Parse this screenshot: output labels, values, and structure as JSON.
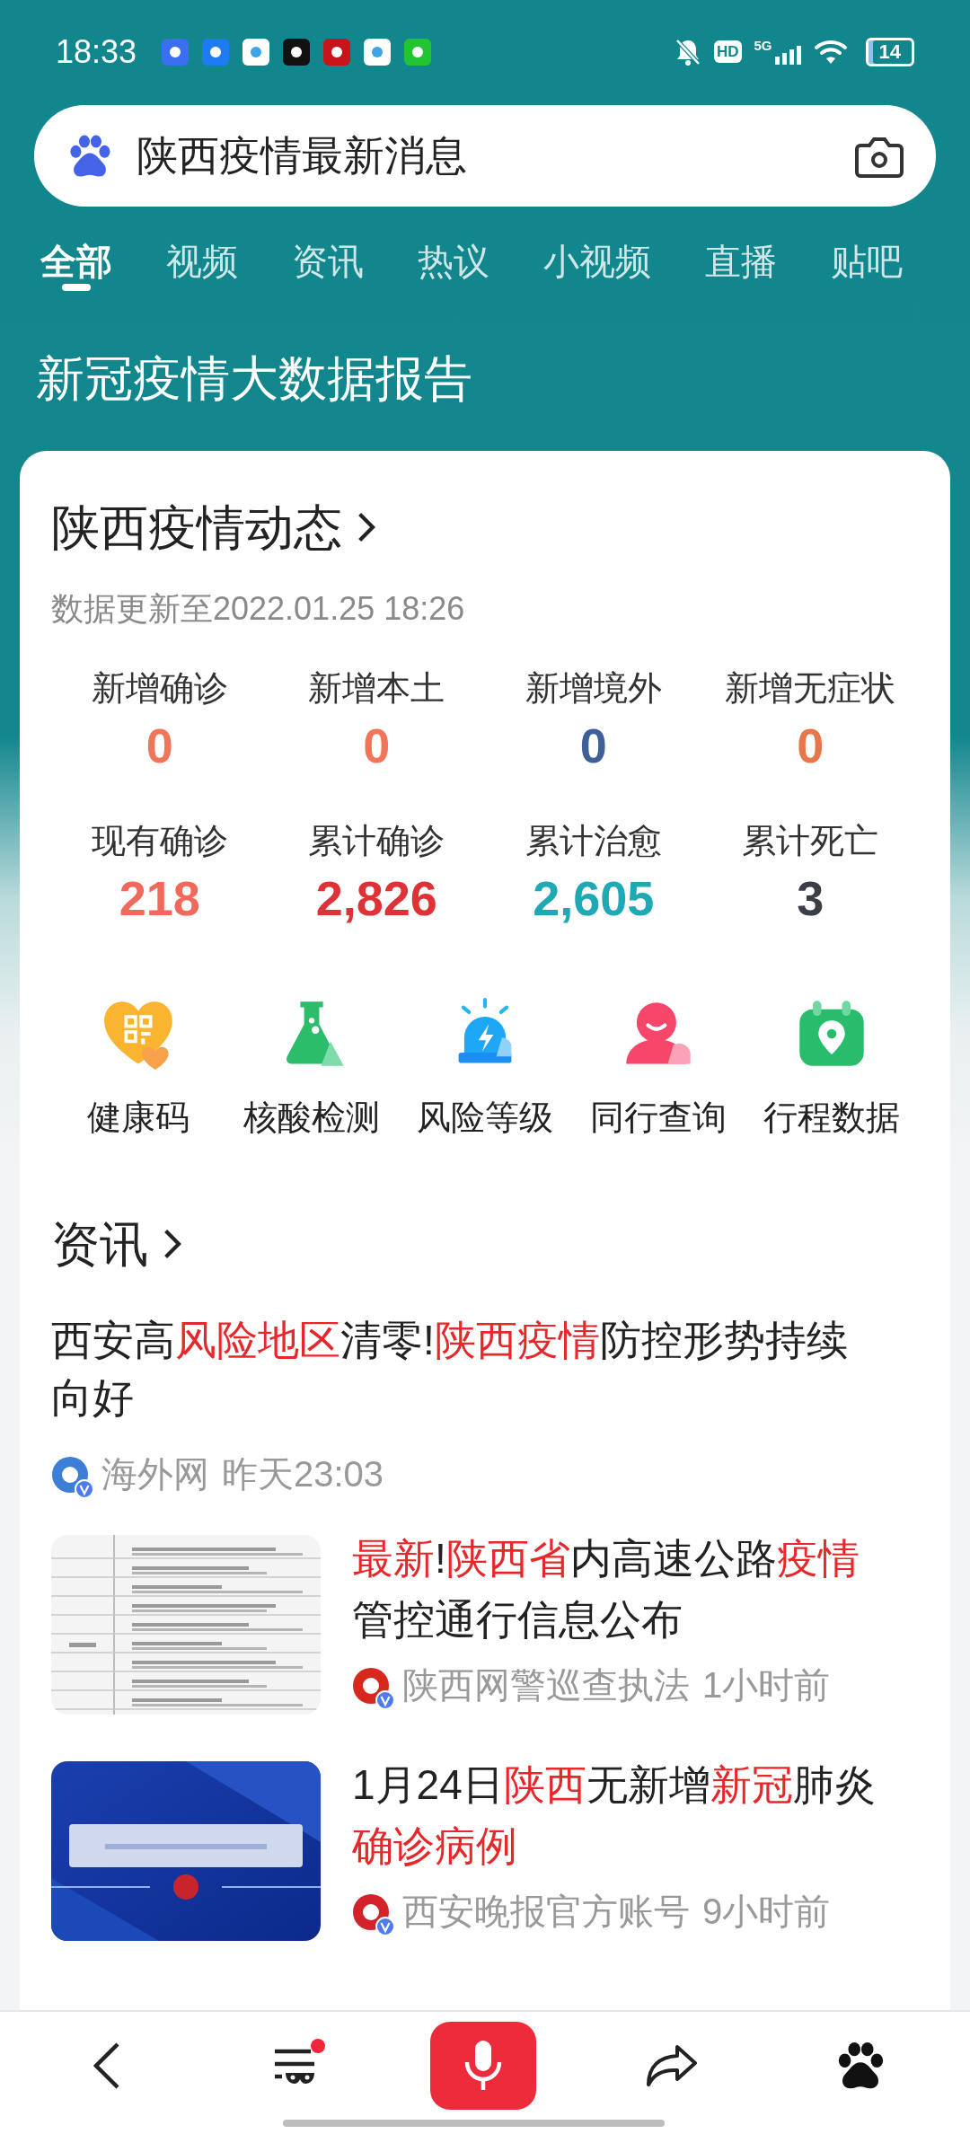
{
  "status_bar": {
    "time": "18:33",
    "hd": "HD",
    "network": "5G",
    "battery": "14"
  },
  "search": {
    "value": "陕西疫情最新消息"
  },
  "tabs": [
    {
      "label": "全部",
      "selected": true
    },
    {
      "label": "视频",
      "selected": false
    },
    {
      "label": "资讯",
      "selected": false
    },
    {
      "label": "热议",
      "selected": false
    },
    {
      "label": "小视频",
      "selected": false
    },
    {
      "label": "直播",
      "selected": false
    },
    {
      "label": "贴吧",
      "selected": false
    }
  ],
  "banner_title": "新冠疫情大数据报告",
  "dashboard": {
    "title": "陕西疫情动态",
    "updated": "数据更新至2022.01.25 18:26",
    "stats": [
      {
        "label": "新增确诊",
        "value": "0",
        "color": "#f07559"
      },
      {
        "label": "新增本土",
        "value": "0",
        "color": "#f07559"
      },
      {
        "label": "新增境外",
        "value": "0",
        "color": "#3f5f98"
      },
      {
        "label": "新增无症状",
        "value": "0",
        "color": "#e7764a"
      },
      {
        "label": "现有确诊",
        "value": "218",
        "color": "#f0695a"
      },
      {
        "label": "累计确诊",
        "value": "2,826",
        "color": "#de3236"
      },
      {
        "label": "累计治愈",
        "value": "2,605",
        "color": "#1ea9b4"
      },
      {
        "label": "累计死亡",
        "value": "3",
        "color": "#3b3e46"
      }
    ],
    "shortcuts": [
      {
        "label": "健康码",
        "kind": "health-code"
      },
      {
        "label": "核酸检测",
        "kind": "flask"
      },
      {
        "label": "风险等级",
        "kind": "siren"
      },
      {
        "label": "同行查询",
        "kind": "person"
      },
      {
        "label": "行程数据",
        "kind": "itinerary"
      }
    ]
  },
  "news": {
    "title": "资讯",
    "items": [
      {
        "kind": "text",
        "color": "#3d7fd6",
        "source": "海外网",
        "time": "昨天23:03",
        "title": [
          {
            "text": "西安高",
            "highlight": false
          },
          {
            "text": "风险地区",
            "highlight": true
          },
          {
            "text": "清零!",
            "highlight": false
          },
          {
            "text": "陕西疫情",
            "highlight": true
          },
          {
            "text": "防控形势持续向好",
            "highlight": false
          }
        ]
      },
      {
        "kind": "thumbnail",
        "color": "#d8281e",
        "source": "陕西网警巡查执法",
        "time": "1小时前",
        "title": [
          {
            "text": "最新",
            "highlight": true
          },
          {
            "text": "!",
            "highlight": false
          },
          {
            "text": "陕西省",
            "highlight": true
          },
          {
            "text": "内高速公路",
            "highlight": false
          },
          {
            "text": "疫情",
            "highlight": true
          },
          {
            "text": "管控通行信息公布",
            "highlight": false
          }
        ]
      },
      {
        "kind": "thumbnail",
        "color": "#d2232a",
        "source": "西安晚报官方账号",
        "time": "9小时前",
        "title": [
          {
            "text": "1月24日",
            "highlight": false
          },
          {
            "text": "陕西",
            "highlight": true
          },
          {
            "text": "无新增",
            "highlight": false
          },
          {
            "text": "新冠",
            "highlight": true
          },
          {
            "text": "肺炎",
            "highlight": false
          },
          {
            "text": "确诊病例",
            "highlight": true
          }
        ]
      }
    ]
  },
  "bottom_bar": [
    {
      "kind": "back",
      "dot": false
    },
    {
      "kind": "menu",
      "dot": true
    },
    {
      "kind": "voice",
      "dot": false
    },
    {
      "kind": "share",
      "dot": false
    },
    {
      "kind": "home",
      "dot": false
    }
  ]
}
